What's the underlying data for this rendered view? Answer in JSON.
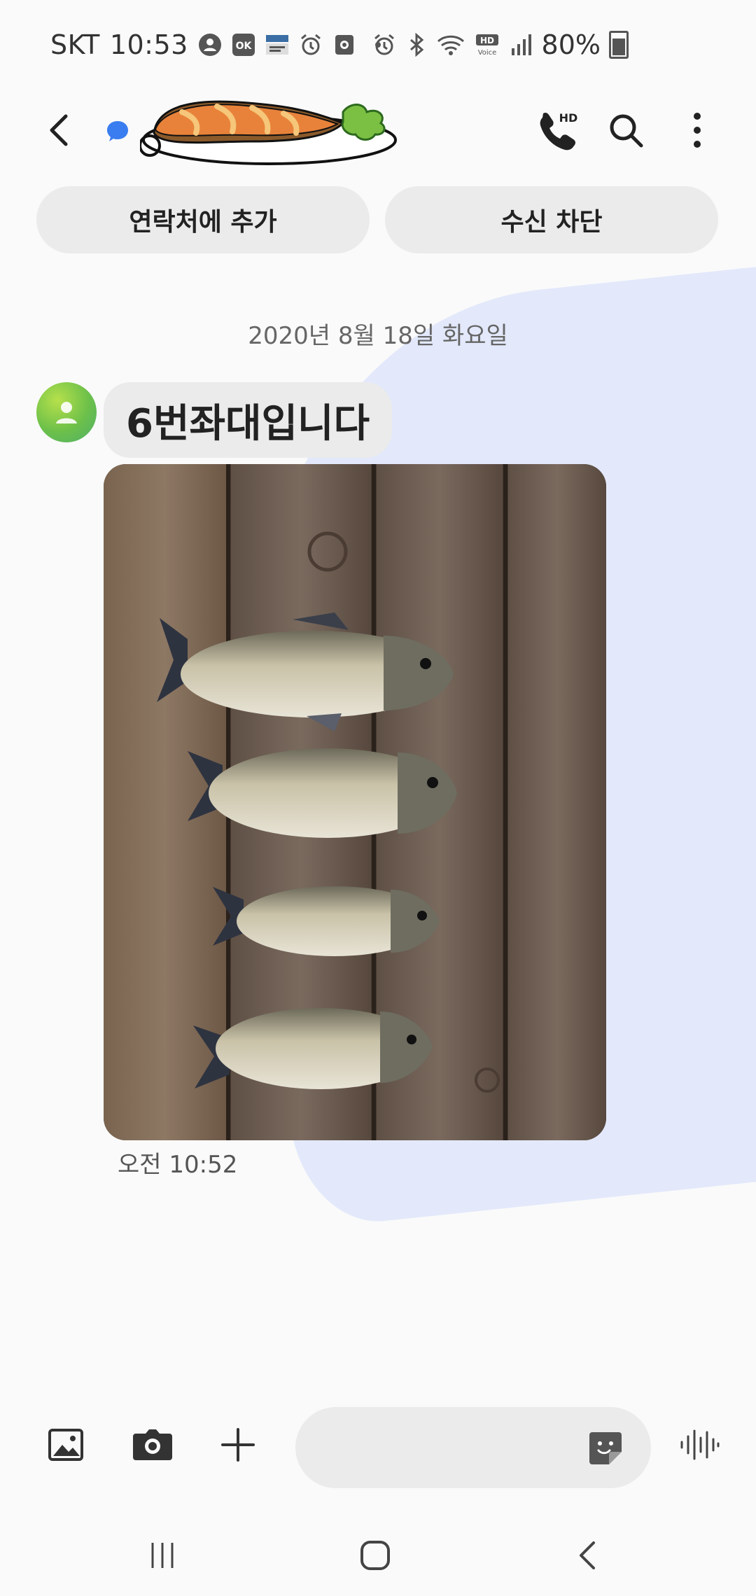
{
  "status_bar": {
    "carrier": "SKT",
    "time": "10:53",
    "battery": "80%",
    "icons": [
      "account-icon",
      "ok-cashbag-icon",
      "ytn-news-icon",
      "alarm-icon",
      "screen-record-icon",
      "dot-icon",
      "alarm-icon",
      "bluetooth-icon",
      "wifi-icon",
      "hd-voice-icon",
      "signal-icon",
      "battery-icon"
    ],
    "ok_badge": "OK",
    "hd_label": "HD",
    "voice_label": "Voice"
  },
  "header": {
    "back_icon": "back-arrow-icon",
    "contact_image": "salmon-sticker",
    "call_icon": "hd-call-icon",
    "call_badge": "HD",
    "search_icon": "search-icon",
    "more_icon": "more-vertical-icon"
  },
  "actions": {
    "add_contact": "연락처에 추가",
    "block": "수신 차단"
  },
  "conversation": {
    "date": "2020년 8월 18일 화요일",
    "message_text": "6번좌대입니다",
    "photo_subject": "four-fish-on-wooden-deck",
    "message_time": "오전 10:52"
  },
  "composer": {
    "input_value": "",
    "input_placeholder": "",
    "gallery_icon": "image-icon",
    "camera_icon": "camera-icon",
    "plus_icon": "plus-icon",
    "sticker_icon": "sticker-icon",
    "voice_icon": "voice-waveform-icon"
  },
  "navbar": {
    "recent_icon": "recent-apps-icon",
    "home_icon": "home-icon",
    "back_icon": "nav-back-icon"
  },
  "colors": {
    "background": "#fafafa",
    "bubble": "#ebebeb",
    "accent_blue": "#3a7df0",
    "bg_shape": "#e3e9fb",
    "avatar_green": "#7cc64a"
  }
}
